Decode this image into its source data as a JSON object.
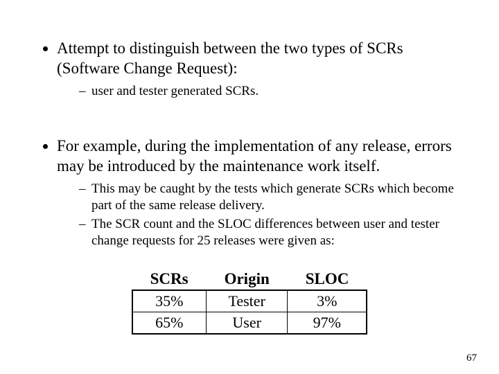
{
  "bullets": {
    "b1": "Attempt to distinguish between the two types of SCRs (Software Change Request):",
    "b1_sub": {
      "s1": "user and tester generated SCRs."
    },
    "b2": "For example, during the implementation of any release, errors may be introduced by the maintenance work itself.",
    "b2_sub": {
      "s1": "This may be caught by the tests which generate SCRs which become part of the same release delivery.",
      "s2": "The SCR count and the SLOC differences between user and tester change requests for 25 releases were given as:"
    }
  },
  "table": {
    "headers": {
      "c1": "SCRs",
      "c2": "Origin",
      "c3": "SLOC"
    },
    "row1": {
      "c1": "35%",
      "c2": "Tester",
      "c3": "3%"
    },
    "row2": {
      "c1": "65%",
      "c2": "User",
      "c3": "97%"
    }
  },
  "page_number": "67",
  "chart_data": {
    "type": "table",
    "title": "SCR count and SLOC differences between user and tester change requests for 25 releases",
    "columns": [
      "SCRs",
      "Origin",
      "SLOC"
    ],
    "rows": [
      {
        "SCRs": "35%",
        "Origin": "Tester",
        "SLOC": "3%"
      },
      {
        "SCRs": "65%",
        "Origin": "User",
        "SLOC": "97%"
      }
    ]
  }
}
